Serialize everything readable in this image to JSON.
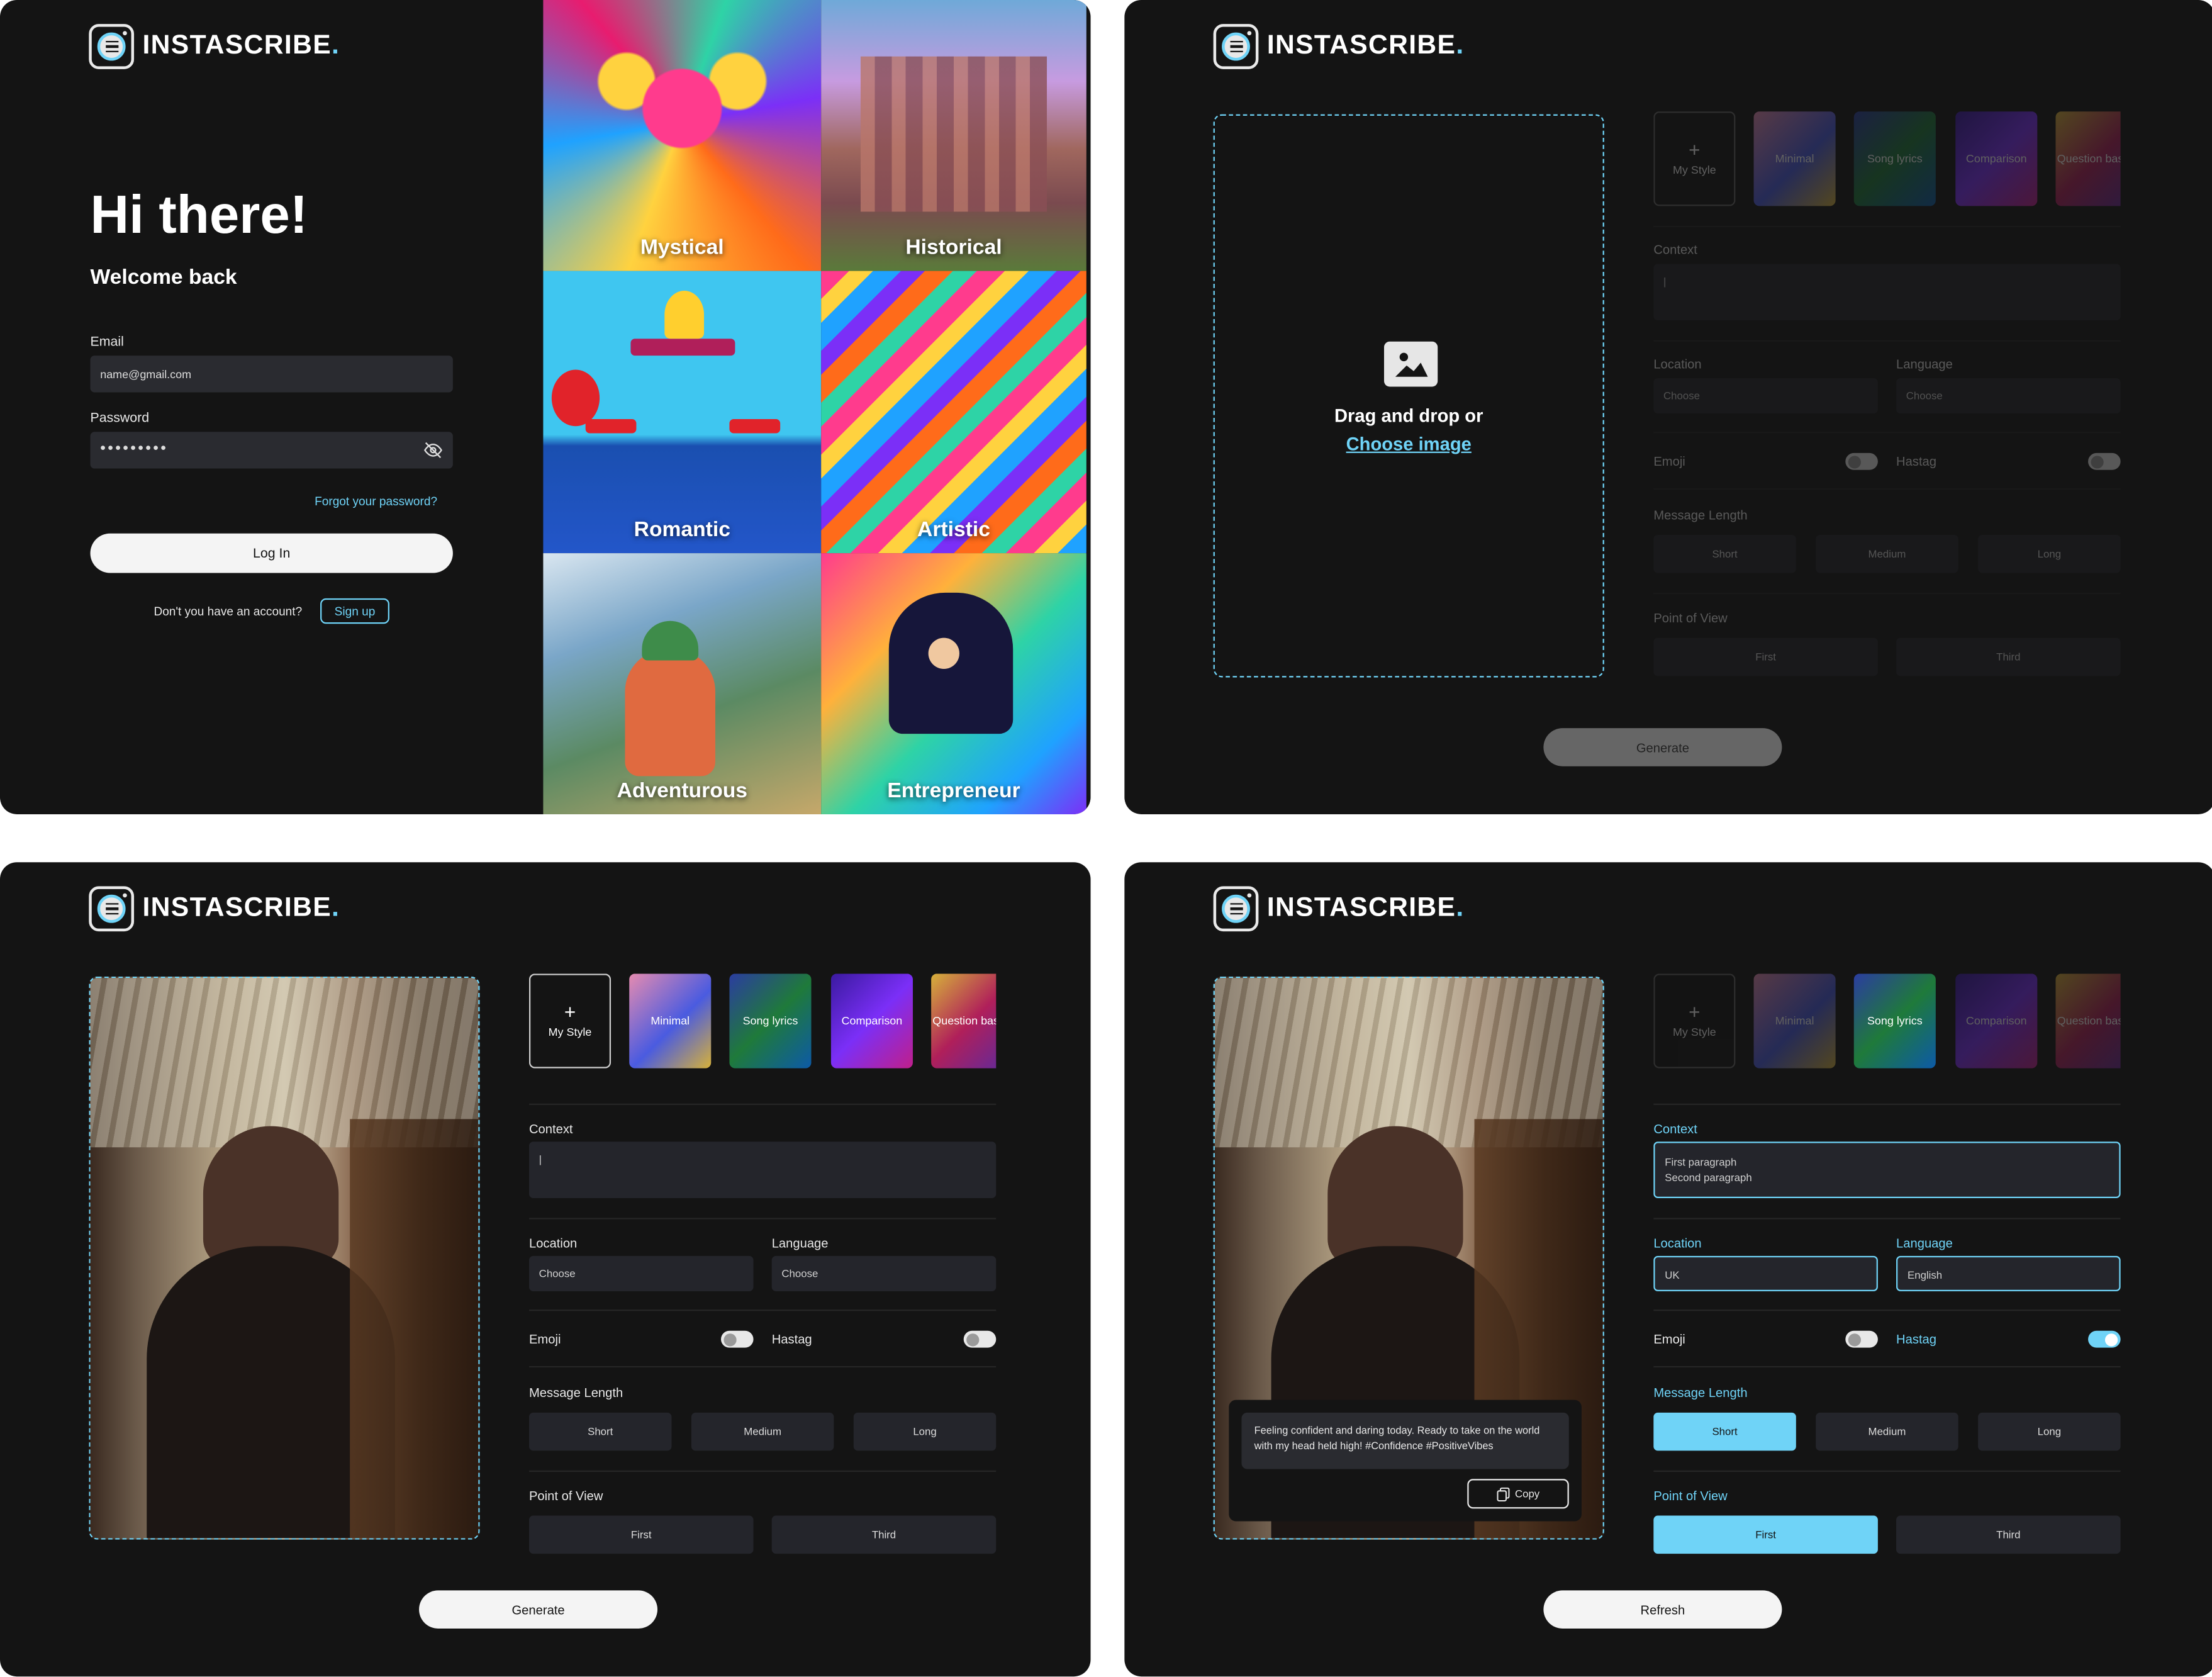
{
  "brand": {
    "name": "INSTASCRIBE",
    "dot": ".",
    "accent": "#6fd3f7"
  },
  "login": {
    "greeting": "Hi there!",
    "subtitle": "Welcome back",
    "email_label": "Email",
    "email_value": "name@gmail.com",
    "password_label": "Password",
    "password_value": "•••••••••",
    "forgot": "Forgot your password?",
    "login_button": "Log In",
    "no_account": "Don't you have an account?",
    "signup": "Sign up"
  },
  "gallery": [
    "Mystical",
    "Historical",
    "Romantic",
    "Artistic",
    "Adventurous",
    "Entrepreneur"
  ],
  "upload": {
    "line1": "Drag and drop or",
    "link": "Choose image"
  },
  "styles": {
    "my_style": "My Style",
    "items": [
      "Minimal",
      "Song lyrics",
      "Comparison",
      "Question based"
    ]
  },
  "form": {
    "context_label": "Context",
    "context_cursor": "|",
    "location_label": "Location",
    "language_label": "Language",
    "choose": "Choose",
    "emoji_label": "Emoji",
    "hashtag_label": "Hastag",
    "length_label": "Message Length",
    "length_options": [
      "Short",
      "Medium",
      "Long"
    ],
    "pov_label": "Point of View",
    "pov_options": [
      "First",
      "Third"
    ]
  },
  "filled": {
    "context_line1": "First paragraph",
    "context_line2": "Second paragraph",
    "location": "UK",
    "language": "English",
    "selected_style": "Song lyrics",
    "emoji_on": false,
    "hashtag_on": true,
    "length": "Short",
    "pov": "First"
  },
  "result": {
    "text": "Feeling confident and daring today. Ready to take on the world with my head held high! #Confidence #PositiveVibes",
    "copy": "Copy"
  },
  "buttons": {
    "generate": "Generate",
    "refresh": "Refresh"
  }
}
